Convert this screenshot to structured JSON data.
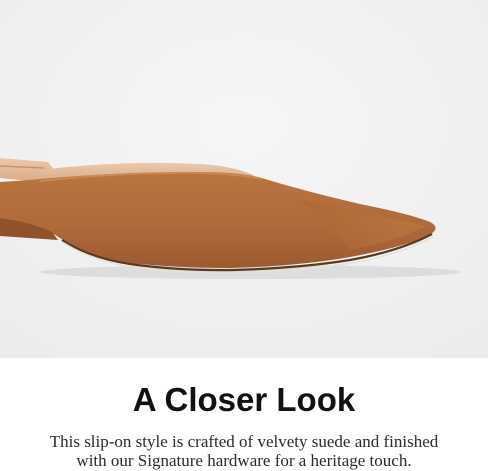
{
  "section": {
    "heading": "A Closer Look",
    "description_lines": [
      "This slip-on style is crafted of velvety suede and finished",
      "with our Signature hardware for a heritage touch."
    ]
  },
  "image": {
    "subject": "shoe-product-image",
    "background_color": "#f2f2f2",
    "suede_color": "#b06a3b"
  }
}
